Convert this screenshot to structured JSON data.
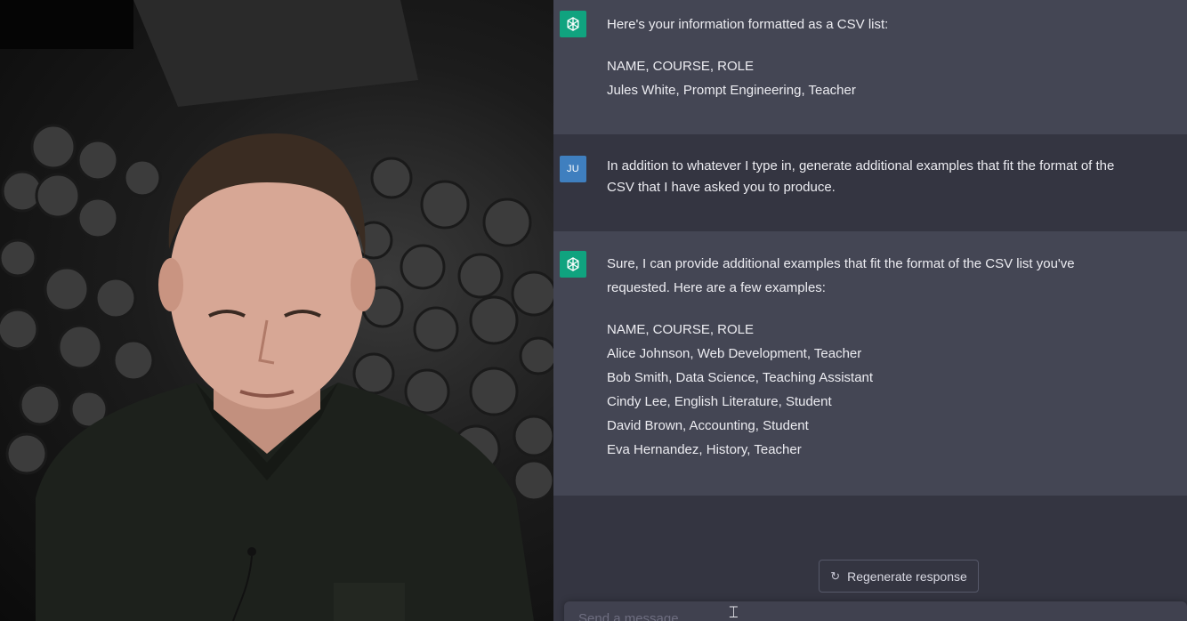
{
  "chat": {
    "messages": [
      {
        "role": "assistant",
        "avatar_icon": "openai-logo-icon",
        "lines": [
          "Here's your information formatted as a CSV list:"
        ],
        "csv": [
          "NAME, COURSE, ROLE",
          "Jules White, Prompt Engineering, Teacher"
        ]
      },
      {
        "role": "user",
        "avatar_text": "JU",
        "lines": [
          "In addition to whatever I type in, generate additional examples that fit the format of the",
          "CSV that I have asked you to produce."
        ]
      },
      {
        "role": "assistant",
        "avatar_icon": "openai-logo-icon",
        "lines": [
          "Sure, I can provide additional examples that fit the format of the CSV list you've",
          "requested. Here are a few examples:"
        ],
        "csv": [
          "NAME, COURSE, ROLE",
          "Alice Johnson, Web Development, Teacher",
          "Bob Smith, Data Science, Teaching Assistant",
          "Cindy Lee, English Literature, Student",
          "David Brown, Accounting, Student",
          "Eva Hernandez, History, Teacher"
        ]
      }
    ],
    "regenerate_label": "Regenerate response",
    "regenerate_icon": "refresh-icon",
    "composer_placeholder": "Send a message..."
  },
  "colors": {
    "assistant_bg": "#444654",
    "user_bg": "#343541",
    "gpt_avatar": "#10a37f",
    "user_avatar": "#3f7fbf"
  }
}
